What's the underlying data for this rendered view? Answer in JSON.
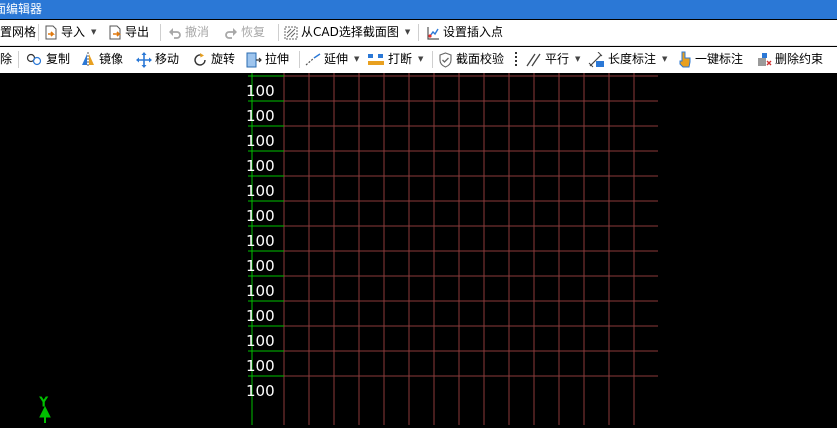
{
  "window": {
    "title": "面编辑器"
  },
  "toolbar1": {
    "grid": "置网格",
    "import": "导入",
    "export": "导出",
    "undo": "撤消",
    "redo": "恢复",
    "from_cad": "从CAD选择截面图",
    "set_insert": "设置插入点"
  },
  "toolbar2": {
    "delete": "除",
    "copy": "复制",
    "mirror": "镜像",
    "move": "移动",
    "rotate": "旋转",
    "stretch": "拉伸",
    "extend": "延伸",
    "break": "打断",
    "section_check": "截面校验",
    "parallel": "平行",
    "length_dim": "长度标注",
    "one_key_dim": "一键标注",
    "delete_constraint": "删除约束"
  },
  "canvas": {
    "row_labels": [
      "100",
      "100",
      "100",
      "100",
      "100",
      "100",
      "100",
      "100",
      "100",
      "100",
      "100",
      "100",
      "100"
    ],
    "axis_y_label": "Y",
    "colors": {
      "grid": "#8b3a3a",
      "axis": "#00c000",
      "text": "#ffffff"
    }
  }
}
